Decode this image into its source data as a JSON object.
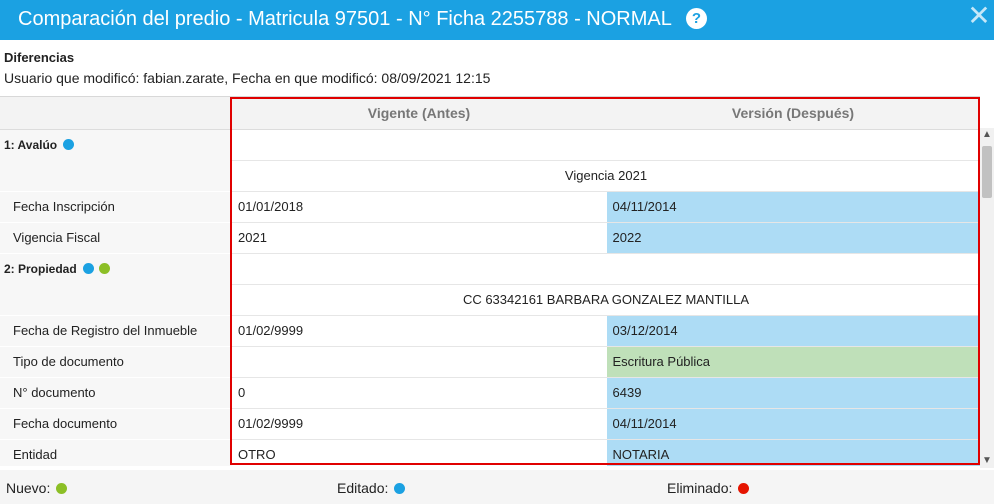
{
  "window": {
    "title": "Comparación del predio - Matricula 97501 - N° Ficha 2255788 - NORMAL",
    "help_glyph": "?",
    "close_glyph": "✕",
    "accent_color": "#1ba1e2"
  },
  "header": {
    "heading": "Diferencias",
    "info": "Usuario que modificó: fabian.zarate, Fecha en que modificó: 08/09/2021 12:15"
  },
  "table": {
    "col_before": "Vigente (Antes)",
    "col_after": "Versión (Después)",
    "sections": [
      {
        "title": "1: Avalúo",
        "group": "Vigencia 2021",
        "rows": [
          {
            "label": "Fecha Inscripción",
            "before": "01/01/2018",
            "after": "04/11/2014",
            "status": "edited"
          },
          {
            "label": "Vigencia Fiscal",
            "before": "2021",
            "after": "2022",
            "status": "edited"
          }
        ]
      },
      {
        "title": "2: Propiedad",
        "group": "CC 63342161 BARBARA GONZALEZ MANTILLA",
        "rows": [
          {
            "label": "Fecha de Registro del Inmueble",
            "before": "01/02/9999",
            "after": "03/12/2014",
            "status": "edited"
          },
          {
            "label": "Tipo de documento",
            "before": "",
            "after": "Escritura Pública",
            "status": "new"
          },
          {
            "label": "N° documento",
            "before": "0",
            "after": "6439",
            "status": "edited"
          },
          {
            "label": "Fecha documento",
            "before": "01/02/9999",
            "after": "04/11/2014",
            "status": "edited"
          },
          {
            "label": "Entidad",
            "before": "OTRO",
            "after": "NOTARIA",
            "status": "edited"
          }
        ]
      }
    ]
  },
  "legend": {
    "new_label": "Nuevo:",
    "edited_label": "Editado:",
    "deleted_label": "Eliminado:",
    "new_color": "#8cbf26",
    "edited_color": "#1ba1e2",
    "deleted_color": "#e51400"
  },
  "scrollbar": {
    "up_glyph": "▲",
    "down_glyph": "▼"
  }
}
